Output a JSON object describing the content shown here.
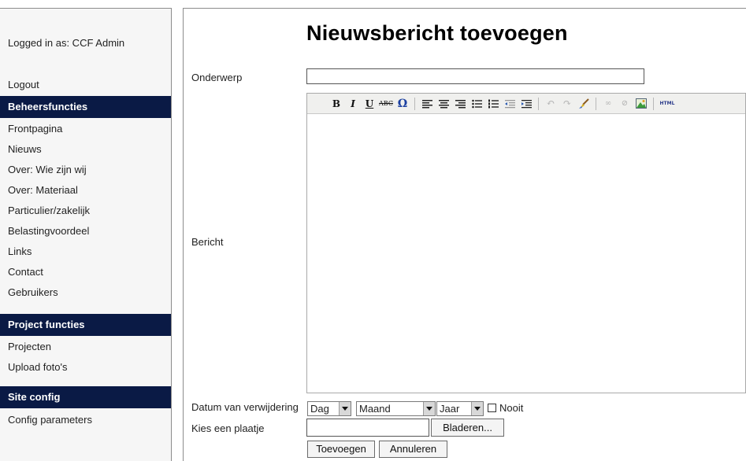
{
  "sidebar": {
    "login_text": "Logged in as: CCF Admin",
    "logout_label": "Logout",
    "sections": [
      {
        "title": "Beheersfuncties",
        "items": [
          "Frontpagina",
          "Nieuws",
          "Over: Wie zijn wij",
          "Over: Materiaal",
          "Particulier/zakelijk",
          "Belastingvoordeel",
          "Links",
          "Contact",
          "Gebruikers"
        ]
      },
      {
        "title": "Project functies",
        "items": [
          "Projecten",
          "Upload foto's"
        ]
      },
      {
        "title": "Site config",
        "items": [
          "Config parameters"
        ]
      }
    ]
  },
  "main": {
    "title": "Nieuwsbericht toevoegen",
    "labels": {
      "subject": "Onderwerp",
      "message": "Bericht",
      "delete_date": "Datum van verwijdering",
      "image": "Kies een plaatje"
    },
    "subject_value": "",
    "selects": {
      "day": "Dag",
      "month": "Maand",
      "year": "Jaar"
    },
    "never_label": "Nooit",
    "browse_label": "Bladeren...",
    "submit_label": "Toevoegen",
    "cancel_label": "Annuleren"
  },
  "toolbar_icons": [
    "bold-icon",
    "italic-icon",
    "underline-icon",
    "strikethrough-icon",
    "special-char-icon",
    "align-left-icon",
    "align-center-icon",
    "align-right-icon",
    "bullet-list-icon",
    "numbered-list-icon",
    "outdent-icon",
    "indent-icon",
    "undo-icon",
    "redo-icon",
    "cleanup-icon",
    "link-icon",
    "unlink-icon",
    "image-icon",
    "html-source-icon"
  ]
}
